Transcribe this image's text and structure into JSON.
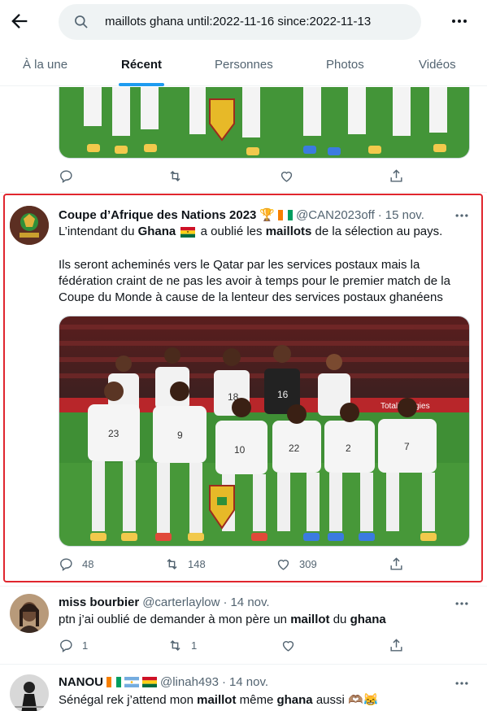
{
  "search": {
    "query": "maillots ghana until:2022-11-16 since:2022-11-13"
  },
  "tabs": [
    {
      "label": "À la une"
    },
    {
      "label": "Récent"
    },
    {
      "label": "Personnes"
    },
    {
      "label": "Photos"
    },
    {
      "label": "Vidéos"
    }
  ],
  "colors": {
    "accent": "#1d9bf0",
    "highlight": "#e0262e",
    "muted": "#536471"
  },
  "tweets": [
    {
      "name": "Coupe d’Afrique des Nations 2023",
      "handle": "@CAN2023off",
      "dot": "·",
      "time": "15 nov.",
      "line1": {
        "a": "L’intendant du ",
        "b1": "Ghana",
        "c": " a oublié les ",
        "b2": "maillots",
        "d": " de la sélection au pays."
      },
      "line2": "Ils seront acheminés vers le Qatar par les services postaux mais la",
      "line3": "fédération craint de ne pas les avoir à temps pour le premier match de la",
      "line4": "Coupe du Monde à cause de la lenteur des services postaux ghanéens",
      "replies": "48",
      "retweets": "148",
      "likes": "309"
    },
    {
      "name": "miss bourbier",
      "handle": "@carterlaylow",
      "dot": "·",
      "time": "14 nov.",
      "text": {
        "a": "ptn j’ai oublié de demander à mon père un ",
        "b1": "maillot",
        "c": " du ",
        "b2": "ghana"
      },
      "replies": "1",
      "retweets": "1"
    },
    {
      "name": "NANOU",
      "handle": "@linah493",
      "dot": "·",
      "time": "14 nov.",
      "text": {
        "a": "Sénégal rek j’attend mon ",
        "b1": "maillot",
        "c": " même ",
        "b2": "ghana",
        "d": " aussi 🫶🏽😹"
      }
    }
  ],
  "photo": {
    "banner": "TotalEnergies",
    "numbers": [
      "23",
      "9",
      "10",
      "22",
      "2",
      "7",
      "18",
      "16"
    ]
  }
}
